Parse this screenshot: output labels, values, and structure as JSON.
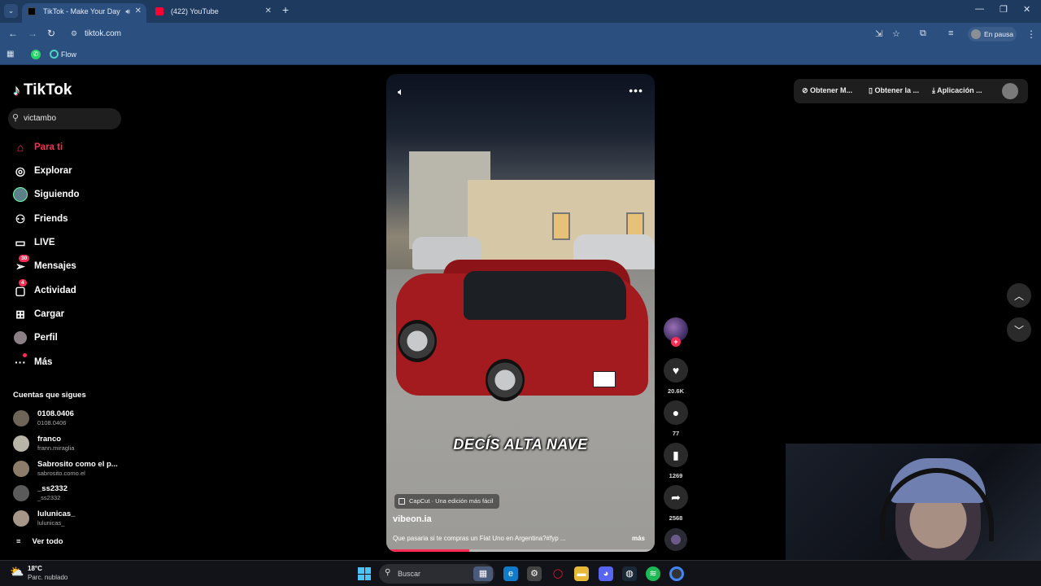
{
  "browser": {
    "tabs": [
      {
        "title": "TikTok - Make Your Day",
        "active": true
      },
      {
        "title": "(422) YouTube",
        "active": false
      }
    ],
    "url": "tiktok.com",
    "profile_label": "En pausa",
    "bookmarks": [
      {
        "label": "Flow"
      }
    ]
  },
  "sidebar": {
    "brand": "TikTok",
    "search_value": "victambo",
    "nav": [
      {
        "label": "Para ti",
        "icon": "home-icon",
        "active": true
      },
      {
        "label": "Explorar",
        "icon": "compass-icon"
      },
      {
        "label": "Siguiendo",
        "icon": "following-avatar-icon"
      },
      {
        "label": "Friends",
        "icon": "friends-icon"
      },
      {
        "label": "LIVE",
        "icon": "live-icon"
      },
      {
        "label": "Mensajes",
        "icon": "messages-icon",
        "badge": "30"
      },
      {
        "label": "Actividad",
        "icon": "activity-icon",
        "badge": "4"
      },
      {
        "label": "Cargar",
        "icon": "upload-icon"
      },
      {
        "label": "Perfil",
        "icon": "profile-avatar-icon"
      },
      {
        "label": "Más",
        "icon": "more-icon"
      }
    ],
    "following_title": "Cuentas que sigues",
    "following": [
      {
        "name": "0108.0406",
        "handle": "0108.0406"
      },
      {
        "name": "franco",
        "handle": "frann.miraglia"
      },
      {
        "name": "Sabrosito como el p...",
        "handle": "sabrosito.como.el"
      },
      {
        "name": "_ss2332",
        "handle": "_ss2332"
      },
      {
        "name": "lulunicas_",
        "handle": "lulunicas_"
      }
    ],
    "see_all": "Ver todo"
  },
  "video": {
    "overlay_text": "DECÍS ALTA NAVE",
    "capcut_label": "CapCut · Una edición más fácil",
    "author": "vibeon.ia",
    "description": "Que pasaria si te compras un Fiat Uno en Argentina?#fyp ...",
    "more_label": "más",
    "progress": 0.31
  },
  "actions": {
    "likes": "20.6K",
    "comments": "77",
    "saves": "1269",
    "shares": "2568"
  },
  "topbar": {
    "coins": "Obtener M...",
    "app": "Obtener la ...",
    "desktop": "Aplicación ..."
  },
  "taskbar": {
    "temperature": "18°C",
    "weather": "Parc. nublado",
    "search_label": "Buscar"
  },
  "colors": {
    "accent": "#fe2c55",
    "chrome": "#2b4f7e",
    "bg": "#000000"
  }
}
